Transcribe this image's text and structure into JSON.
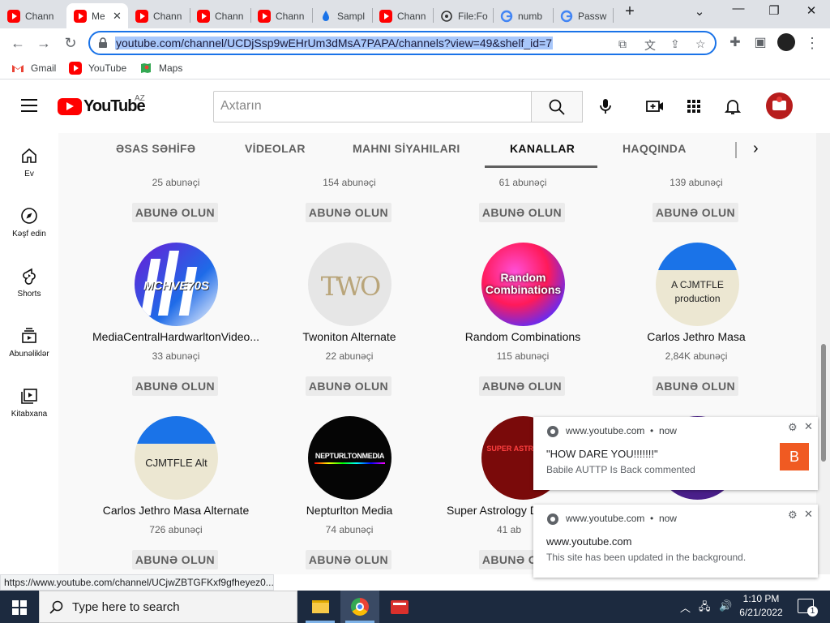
{
  "browser": {
    "tabs": [
      {
        "title": "Chann",
        "icon": "youtube-icon",
        "active": false
      },
      {
        "title": "Me",
        "icon": "youtube-icon",
        "active": true
      },
      {
        "title": "Chann",
        "icon": "youtube-icon",
        "active": false
      },
      {
        "title": "Chann",
        "icon": "youtube-icon",
        "active": false
      },
      {
        "title": "Chann",
        "icon": "youtube-icon",
        "active": false
      },
      {
        "title": "Sampl",
        "icon": "water-drop-icon",
        "active": false
      },
      {
        "title": "Chann",
        "icon": "youtube-icon",
        "active": false
      },
      {
        "title": "File:Fo",
        "icon": "wikimedia-icon",
        "active": false
      },
      {
        "title": "numb",
        "icon": "google-icon",
        "active": false
      },
      {
        "title": "Passw",
        "icon": "google-icon",
        "active": false
      }
    ],
    "url": "youtube.com/channel/UCDjSsp9wEHrUm3dMsA7PAPA/channels?view=49&shelf_id=7",
    "bookmarks": [
      "Gmail",
      "YouTube",
      "Maps"
    ],
    "status_url": "https://www.youtube.com/channel/UCjwZBTGFKxf9gfheyez0..."
  },
  "youtube": {
    "logo_text": "YouTube",
    "region": "AZ",
    "search_placeholder": "Axtarın",
    "sidebar": [
      "Ev",
      "Kəşf edin",
      "Shorts",
      "Abunəliklər",
      "Kitabxana"
    ],
    "channel_tabs": [
      "ƏSAS SƏHİFƏ",
      "VİDEOLAR",
      "MAHNI SİYAHILARI",
      "KANALLAR",
      "HAQQINDA"
    ],
    "selected_tab": "KANALLAR",
    "subscribe_label": "ABUNƏ OLUN",
    "row1_subs": [
      "25 abunəçi",
      "154 abunəçi",
      "61 abunəçi",
      "139 abunəçi"
    ],
    "row2": [
      {
        "name": "MediaCentralHardwarltonVideo...",
        "subs": "33 abunəçi",
        "avatar_text": "MCHVE70S"
      },
      {
        "name": "Twoniton Alternate",
        "subs": "22 abunəçi",
        "avatar_text": "TWO"
      },
      {
        "name": "Random Combinations",
        "subs": "115 abunəçi",
        "avatar_text": "Random Combinations"
      },
      {
        "name": "Carlos Jethro Masa",
        "subs": "2,84K abunəçi",
        "avatar_text": "A CJMTFLE production"
      }
    ],
    "row3": [
      {
        "name": "Carlos Jethro Masa Alternate",
        "subs": "726 abunəçi",
        "avatar_text": "CJMTFLE Alt"
      },
      {
        "name": "Nepturlton Media",
        "subs": "74 abunəçi",
        "avatar_text": "NEPTURLTONMEDIA"
      },
      {
        "name": "Super Astrology D",
        "subs": "41 ab",
        "avatar_text": "SUPER ASTROLOGY"
      },
      {
        "name": "",
        "subs": "",
        "avatar_text": ""
      }
    ]
  },
  "notifications": [
    {
      "source": "www.youtube.com",
      "time": "now",
      "title": "\"HOW DARE YOU!!!!!!!\"",
      "body": "Babile AUTTP Is Back commented",
      "badge": "B"
    },
    {
      "source": "www.youtube.com",
      "time": "now",
      "title": "www.youtube.com",
      "body": "This site has been updated in the background."
    }
  ],
  "taskbar": {
    "search_placeholder": "Type here to search",
    "time": "1:10 PM",
    "date": "6/21/2022",
    "notification_count": "1"
  },
  "colors": {
    "youtube_red": "#ff0000",
    "selection_blue": "#a8c7fa",
    "notif_badge": "#f05a22"
  }
}
